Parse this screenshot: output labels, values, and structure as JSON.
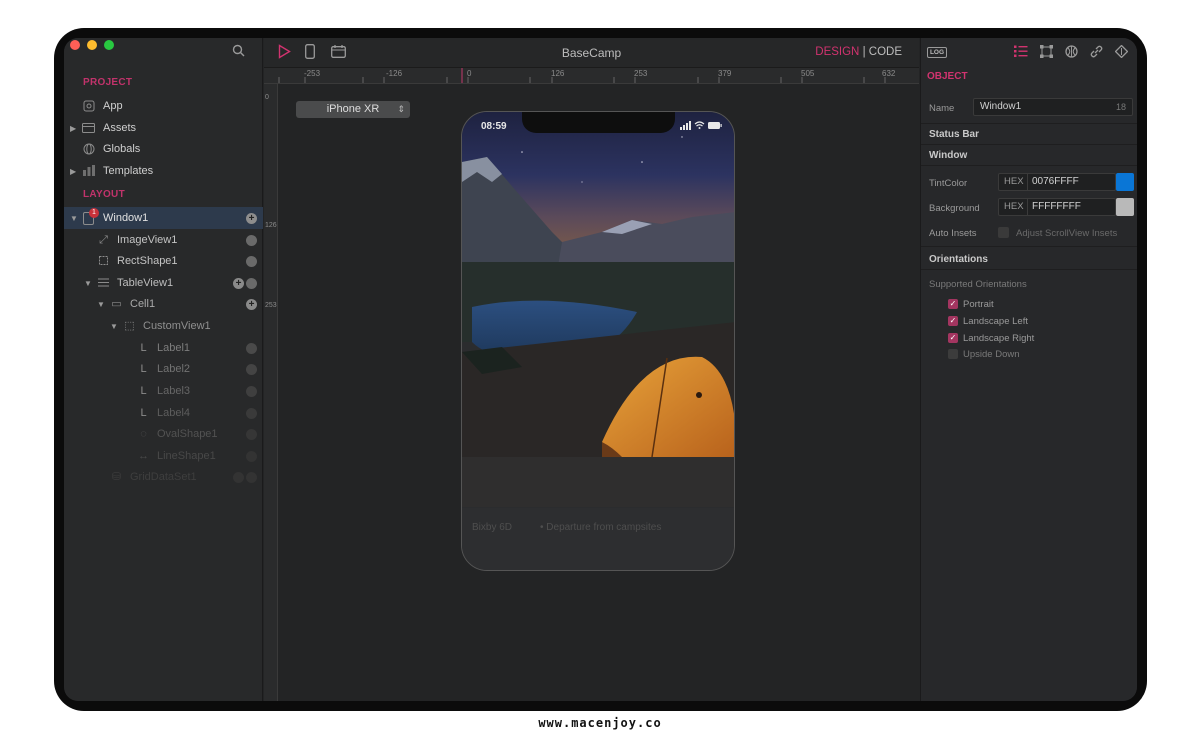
{
  "app": {
    "title": "BaseCamp",
    "mode_design": "DESIGN",
    "mode_sep": "|",
    "mode_code": "CODE"
  },
  "sidebar": {
    "project_heading": "PROJECT",
    "project_items": [
      {
        "label": "App",
        "icon": "app-icon"
      },
      {
        "label": "Assets",
        "icon": "assets-icon"
      },
      {
        "label": "Globals",
        "icon": "globe-icon"
      },
      {
        "label": "Templates",
        "icon": "templates-icon"
      }
    ],
    "layout_heading": "LAYOUT",
    "layout_items": [
      {
        "label": "Window1",
        "badge": "1"
      },
      {
        "label": "ImageView1"
      },
      {
        "label": "RectShape1"
      },
      {
        "label": "TableView1"
      },
      {
        "label": "Cell1"
      },
      {
        "label": "CustomView1"
      },
      {
        "label": "Label1"
      },
      {
        "label": "Label2"
      },
      {
        "label": "Label3"
      },
      {
        "label": "Label4"
      },
      {
        "label": "OvalShape1"
      },
      {
        "label": "LineShape1"
      },
      {
        "label": "GridDataSet1"
      }
    ]
  },
  "ruler": {
    "ticks": [
      "-253",
      "-126",
      "0",
      "126",
      "253",
      "379",
      "505",
      "632"
    ],
    "vticks": [
      "0",
      "126",
      "253"
    ]
  },
  "canvas": {
    "device": "iPhone XR",
    "phone_time": "08:59",
    "bottom_a": "Bixby 6D",
    "bottom_b": "• Departure from campsites"
  },
  "inspector": {
    "title": "OBJECT",
    "log": "LOG",
    "name_label": "Name",
    "name_value": "Window1",
    "name_count": "18",
    "status_bar": "Status Bar",
    "window": "Window",
    "tint_label": "TintColor",
    "hex_label": "HEX",
    "tint_value": "0076FFFF",
    "tint_color": "#0a76d6",
    "bg_label": "Background",
    "bg_value": "FFFFFFFF",
    "bg_color": "#b9b9b9",
    "auto_insets": "Auto Insets",
    "adjust_label": "Adjust ScrollView Insets",
    "orientations": "Orientations",
    "supported": "Supported Orientations",
    "options": [
      {
        "label": "Portrait",
        "checked": true
      },
      {
        "label": "Landscape Left",
        "checked": true
      },
      {
        "label": "Landscape Right",
        "checked": true
      },
      {
        "label": "Upside Down",
        "checked": false
      }
    ]
  },
  "watermark": "www.macenjoy.co"
}
